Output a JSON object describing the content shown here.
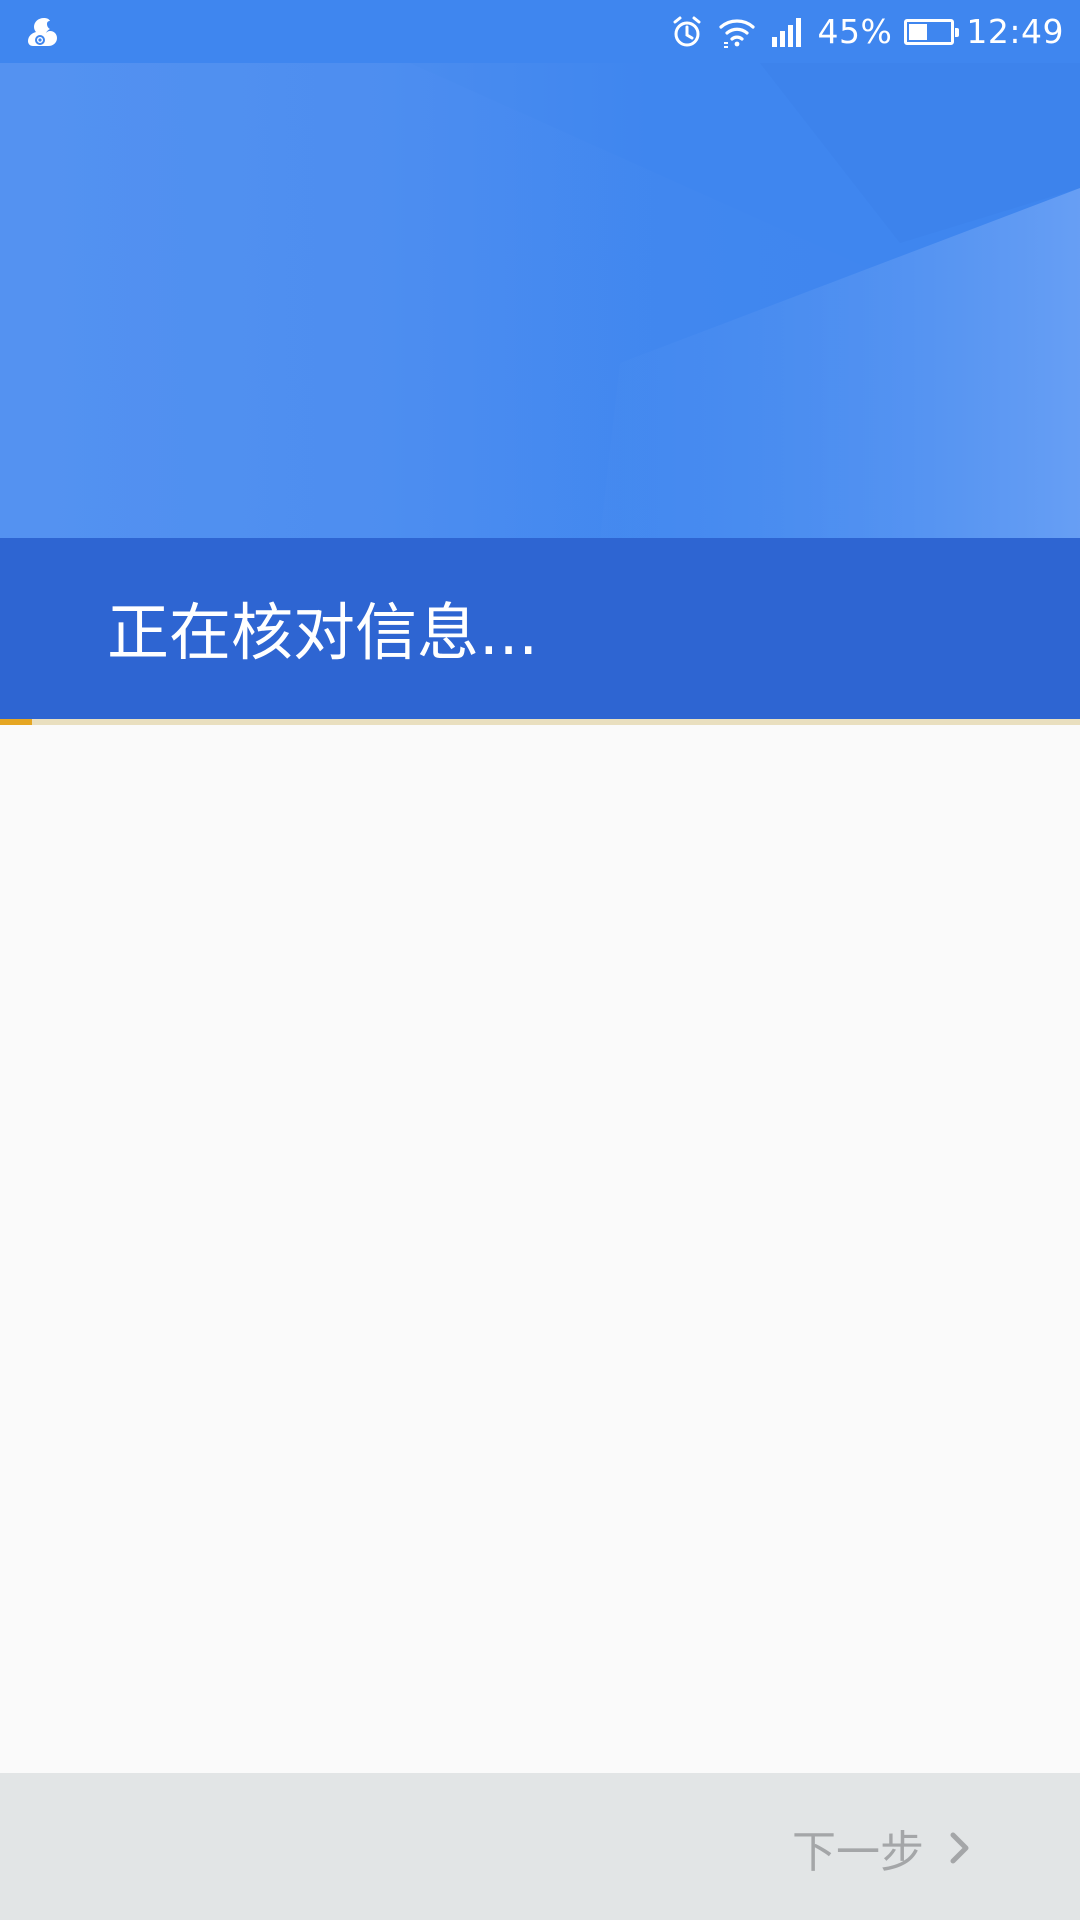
{
  "status_bar": {
    "app_icon": "uc-browser-squirrel-icon",
    "alarm_icon": "alarm-clock-icon",
    "wifi_icon": "wifi-icon",
    "signal_icon": "cellular-signal-icon",
    "battery_percent_text": "45%",
    "battery_level": 0.45,
    "time": "12:49"
  },
  "header": {
    "title": "正在核对信息..."
  },
  "progress": {
    "value": 0.03,
    "color": "#e5a623"
  },
  "footer": {
    "next_label": "下一步",
    "next_icon": "chevron-right-icon"
  },
  "colors": {
    "status_bar": "#3f86ef",
    "hero": "#3f86ef",
    "title_band": "#2e65d2",
    "content_bg": "#fafafa",
    "bottom_bar": "#e2e5e6",
    "disabled_text": "#a4a6a8"
  }
}
